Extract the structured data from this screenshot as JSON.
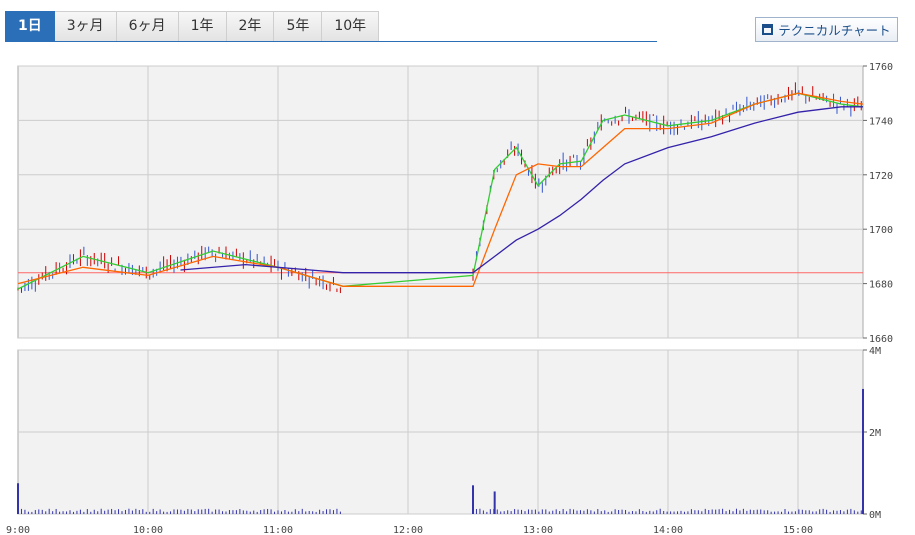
{
  "tabs": [
    {
      "label": "1日",
      "active": true
    },
    {
      "label": "3ヶ月",
      "active": false
    },
    {
      "label": "6ヶ月",
      "active": false
    },
    {
      "label": "1年",
      "active": false
    },
    {
      "label": "2年",
      "active": false
    },
    {
      "label": "5年",
      "active": false
    },
    {
      "label": "10年",
      "active": false
    }
  ],
  "tech_button": {
    "label": "テクニカルチャート",
    "icon": "window-icon"
  },
  "chart_data": [
    {
      "type": "line",
      "panel": "price",
      "x_ticks": [
        "9:00",
        "10:00",
        "11:00",
        "12:00",
        "13:00",
        "14:00",
        "15:00"
      ],
      "ylim": [
        1660,
        1760
      ],
      "y_ticks": [
        "1760",
        "1740",
        "1720",
        "1700",
        "1680",
        "1660"
      ],
      "reference_line": 1684,
      "grid": true,
      "colors": {
        "fast_ma": "#33cc33",
        "mid_ma": "#ff6600",
        "slow_ma": "#3322aa",
        "ref": "#ff6666",
        "up": "#cc0000",
        "down": "#3355cc"
      },
      "series": [
        {
          "name": "",
          "color": "#33cc33",
          "x": [
            "9:00",
            "9:30",
            "10:00",
            "10:30",
            "11:00",
            "11:30",
            "12:30",
            "12:40",
            "12:50",
            "13:00",
            "13:10",
            "13:20",
            "13:30",
            "13:40",
            "14:00",
            "14:20",
            "14:40",
            "15:00",
            "15:20",
            "15:30"
          ],
          "values": [
            1678,
            1690,
            1684,
            1692,
            1686,
            1679,
            1683,
            1722,
            1730,
            1716,
            1724,
            1725,
            1740,
            1742,
            1738,
            1740,
            1746,
            1750,
            1746,
            1745
          ]
        },
        {
          "name": "",
          "color": "#ff6600",
          "x": [
            "9:00",
            "9:30",
            "10:00",
            "10:30",
            "11:00",
            "11:30",
            "12:30",
            "12:40",
            "12:50",
            "13:00",
            "13:10",
            "13:20",
            "13:30",
            "13:40",
            "14:00",
            "14:20",
            "14:40",
            "15:00",
            "15:20",
            "15:30"
          ],
          "values": [
            1680,
            1686,
            1683,
            1690,
            1686,
            1679,
            1679,
            1700,
            1720,
            1724,
            1723,
            1723,
            1730,
            1737,
            1737,
            1739,
            1746,
            1750,
            1747,
            1746
          ]
        },
        {
          "name": "",
          "color": "#3322aa",
          "x": [
            "10:15",
            "10:45",
            "11:15",
            "11:30",
            "12:30",
            "12:40",
            "12:50",
            "13:00",
            "13:10",
            "13:20",
            "13:30",
            "13:40",
            "14:00",
            "14:20",
            "14:40",
            "15:00",
            "15:20",
            "15:30"
          ],
          "values": [
            1685,
            1687,
            1685,
            1684,
            1684,
            1690,
            1696,
            1700,
            1705,
            1711,
            1718,
            1724,
            1730,
            1734,
            1739,
            1743,
            1745,
            1745
          ]
        }
      ]
    },
    {
      "type": "bar",
      "panel": "volume",
      "ylim": [
        0,
        4
      ],
      "y_ticks": [
        "4M",
        "2M",
        "0M"
      ],
      "values_note": "",
      "series": [
        {
          "name": "",
          "color": "#3333aa",
          "x": [
            "9:00",
            "12:30",
            "12:40",
            "15:30"
          ],
          "values": [
            0.75,
            0.7,
            0.55,
            3.05
          ]
        }
      ]
    }
  ]
}
